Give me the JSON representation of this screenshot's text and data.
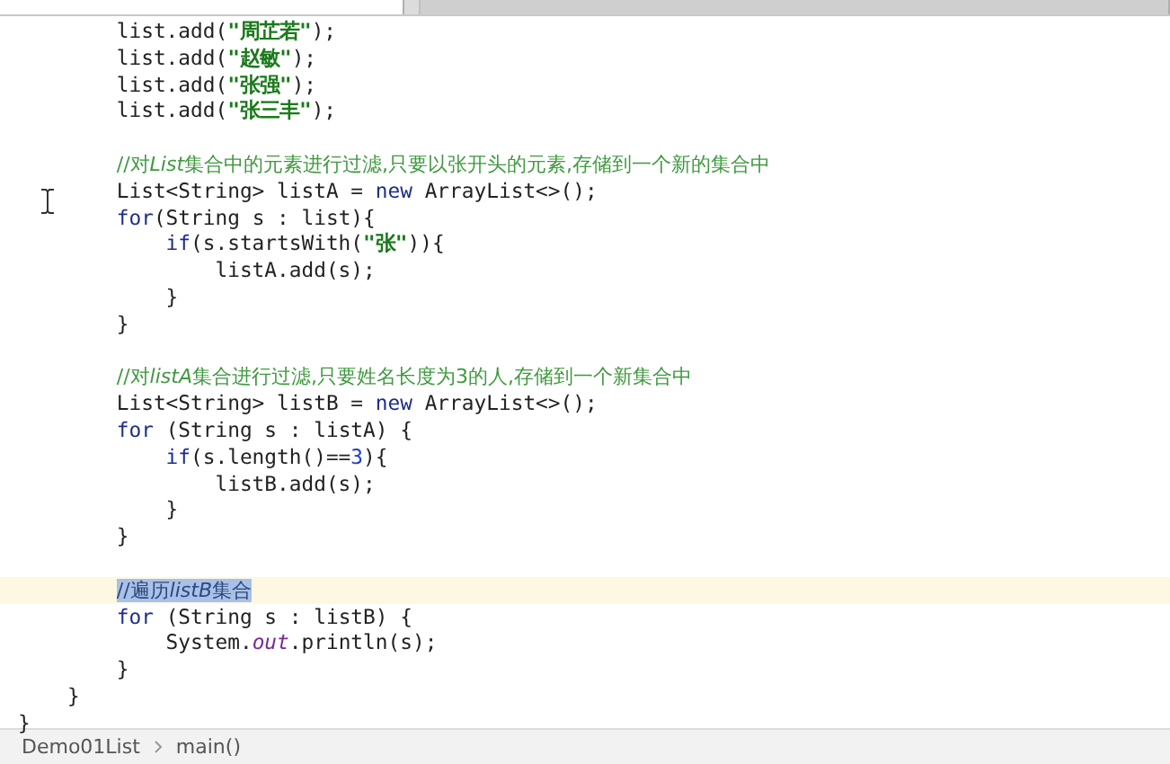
{
  "tabs": [
    {
      "selected": true
    },
    {
      "selected": false
    }
  ],
  "blocks": [
    {
      "lines": [
        {
          "tokens": [
            {
              "kind": "plain",
              "text": "        list.add("
            },
            {
              "kind": "string",
              "text": "\"周芷若\""
            },
            {
              "kind": "plain",
              "text": ");"
            }
          ]
        },
        {
          "tokens": [
            {
              "kind": "plain",
              "text": "        list.add("
            },
            {
              "kind": "string",
              "text": "\"赵敏\""
            },
            {
              "kind": "plain",
              "text": ");"
            }
          ]
        },
        {
          "tokens": [
            {
              "kind": "plain",
              "text": "        list.add("
            },
            {
              "kind": "string",
              "text": "\"张强\""
            },
            {
              "kind": "plain",
              "text": ");"
            }
          ]
        },
        {
          "tokens": [
            {
              "kind": "plain",
              "text": "        list.add("
            },
            {
              "kind": "string",
              "text": "\"张三丰\""
            },
            {
              "kind": "plain",
              "text": ");"
            }
          ]
        }
      ]
    },
    {
      "lines": [
        {
          "tokens": [
            {
              "kind": "comment",
              "text": "        //对"
            },
            {
              "kind": "comment-italic",
              "text": "List"
            },
            {
              "kind": "comment",
              "text": "集合中的元素进行过滤,只要以张开头的元素,存储到一个新的集合中"
            }
          ]
        },
        {
          "tokens": [
            {
              "kind": "plain",
              "text": "        List<String> listA = "
            },
            {
              "kind": "keyword",
              "text": "new"
            },
            {
              "kind": "plain",
              "text": " ArrayList<>();"
            }
          ]
        },
        {
          "tokens": [
            {
              "kind": "keyword",
              "text": "        for"
            },
            {
              "kind": "plain",
              "text": "(String s : list){"
            }
          ]
        },
        {
          "tokens": [
            {
              "kind": "keyword",
              "text": "            if"
            },
            {
              "kind": "plain",
              "text": "(s.startsWith("
            },
            {
              "kind": "string",
              "text": "\"张\""
            },
            {
              "kind": "plain",
              "text": ")){"
            }
          ]
        },
        {
          "tokens": [
            {
              "kind": "plain",
              "text": "                listA.add(s);"
            }
          ]
        },
        {
          "tokens": [
            {
              "kind": "plain",
              "text": "            }"
            }
          ]
        },
        {
          "tokens": [
            {
              "kind": "plain",
              "text": "        }"
            }
          ]
        }
      ]
    },
    {
      "lines": [
        {
          "tokens": [
            {
              "kind": "comment",
              "text": "        //对"
            },
            {
              "kind": "comment-italic",
              "text": "listA"
            },
            {
              "kind": "comment",
              "text": "集合进行过滤,只要姓名长度为3的人,存储到一个新集合中"
            }
          ]
        },
        {
          "tokens": [
            {
              "kind": "plain",
              "text": "        List<String> listB = "
            },
            {
              "kind": "keyword",
              "text": "new"
            },
            {
              "kind": "plain",
              "text": " ArrayList<>();"
            }
          ]
        },
        {
          "tokens": [
            {
              "kind": "keyword",
              "text": "        for"
            },
            {
              "kind": "plain",
              "text": " (String s : listA) {"
            }
          ]
        },
        {
          "tokens": [
            {
              "kind": "keyword",
              "text": "            if"
            },
            {
              "kind": "plain",
              "text": "(s.length()=="
            },
            {
              "kind": "number",
              "text": "3"
            },
            {
              "kind": "plain",
              "text": "){"
            }
          ]
        },
        {
          "tokens": [
            {
              "kind": "plain",
              "text": "                listB.add(s);"
            }
          ]
        },
        {
          "tokens": [
            {
              "kind": "plain",
              "text": "            }"
            }
          ]
        },
        {
          "tokens": [
            {
              "kind": "plain",
              "text": "        }"
            }
          ]
        }
      ]
    },
    {
      "lines": [
        {
          "current": true,
          "tokens": [
            {
              "kind": "selection",
              "text": "        //遍历"
            },
            {
              "kind": "selection-italic",
              "text": "listB"
            },
            {
              "kind": "selection",
              "text": "集合"
            }
          ]
        },
        {
          "tokens": [
            {
              "kind": "keyword",
              "text": "        for"
            },
            {
              "kind": "plain",
              "text": " (String s : listB) {"
            }
          ]
        },
        {
          "tokens": [
            {
              "kind": "plain",
              "text": "            System."
            },
            {
              "kind": "field",
              "text": "out"
            },
            {
              "kind": "plain",
              "text": ".println(s);"
            }
          ]
        },
        {
          "tokens": [
            {
              "kind": "plain",
              "text": "        }"
            }
          ]
        },
        {
          "tokens": [
            {
              "kind": "plain",
              "text": "    }"
            }
          ]
        },
        {
          "tokens": [
            {
              "kind": "plain",
              "text": "}"
            }
          ]
        }
      ]
    }
  ],
  "breadcrumbs": [
    "Demo01List",
    "main()"
  ]
}
